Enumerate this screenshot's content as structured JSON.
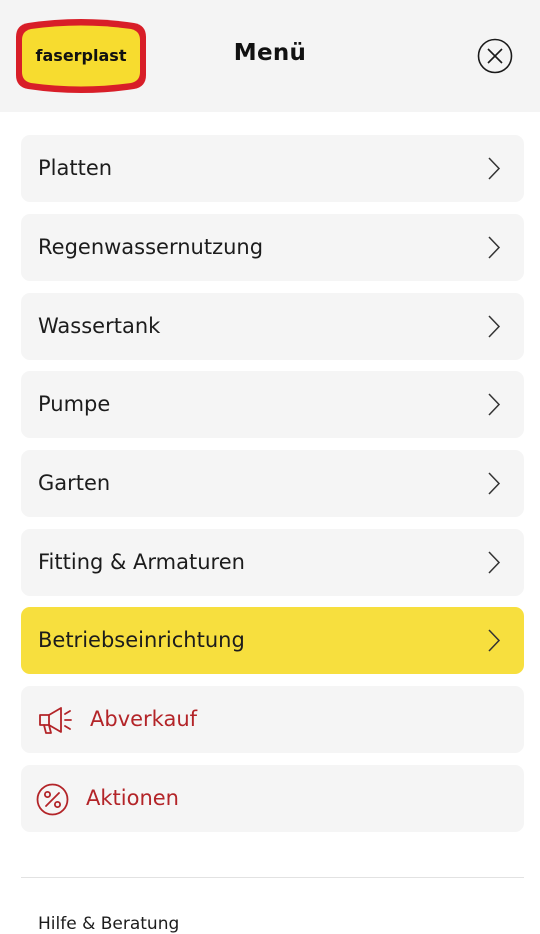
{
  "header": {
    "logo_text": "faserplast",
    "title": "Menü",
    "close_icon": "close-icon"
  },
  "nav": {
    "items": [
      {
        "label": "Platten",
        "active": false
      },
      {
        "label": "Regenwassernutzung",
        "active": false
      },
      {
        "label": "Wassertank",
        "active": false
      },
      {
        "label": "Pumpe",
        "active": false
      },
      {
        "label": "Garten",
        "active": false
      },
      {
        "label": "Fitting & Armaturen",
        "active": false
      },
      {
        "label": "Betriebseinrichtung",
        "active": true
      }
    ]
  },
  "promo": {
    "items": [
      {
        "label": "Abverkauf",
        "icon": "megaphone-icon"
      },
      {
        "label": "Aktionen",
        "icon": "percent-icon"
      }
    ]
  },
  "footer": {
    "help_label": "Hilfe & Beratung"
  },
  "colors": {
    "header_bg": "#f4f4f4",
    "item_bg": "#f5f5f5",
    "active_bg": "#f7df3e",
    "promo_red": "#b32428",
    "logo_yellow": "#f7dc2f",
    "logo_red": "#d81e28"
  }
}
